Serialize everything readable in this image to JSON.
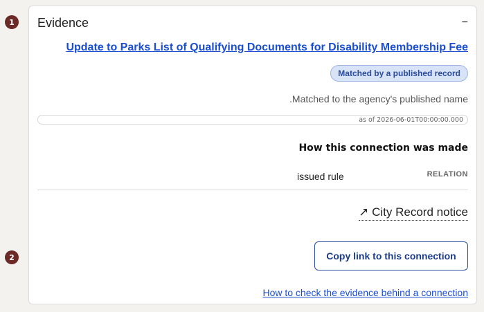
{
  "steps": [
    "1",
    "2"
  ],
  "panel": {
    "title": "Evidence",
    "collapse_symbol": "−",
    "record_link": "Update to Parks List of Qualifying Documents for Disability Membership Fee",
    "badge": "Matched by a published record",
    "match_note": ".Matched to the agency's published name",
    "as_of": "as of 2026-06-01T00:00:00.000",
    "how_heading": "How this connection was made",
    "relation_value": "issued rule",
    "relation_label": "RELATION",
    "notice_icon": "↗",
    "notice_link": "City Record notice",
    "copy_button": "Copy link to this connection",
    "help_link": "How to check the evidence behind a connection"
  },
  "icons": {
    "collapse": "minus-icon",
    "notice": "external-arrow-icon"
  },
  "colors": {
    "step_badge": "#6b2a25",
    "link_blue": "#1a4fd1",
    "badge_bg": "#d9e3f7",
    "badge_text": "#2a4c9a"
  }
}
